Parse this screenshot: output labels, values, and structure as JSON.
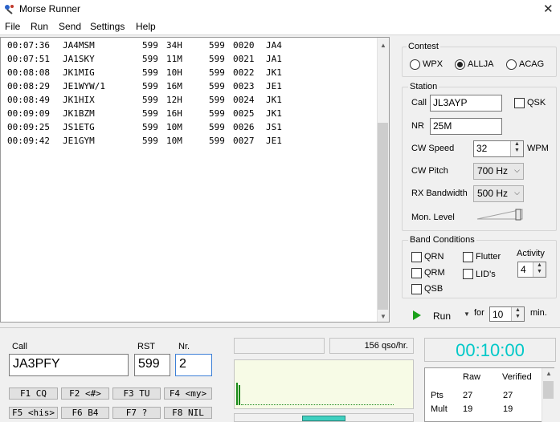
{
  "window": {
    "title": "Morse Runner",
    "close": "✕"
  },
  "menu": [
    "File",
    "Run",
    "Send",
    "Settings",
    "Help"
  ],
  "log": [
    {
      "time": "00:07:36",
      "call": "JA4MSM",
      "rst": "599",
      "exch": "34H",
      "rst_sent": "599",
      "nr": "0020",
      "pfx": "JA4"
    },
    {
      "time": "00:07:51",
      "call": "JA1SKY",
      "rst": "599",
      "exch": "11M",
      "rst_sent": "599",
      "nr": "0021",
      "pfx": "JA1"
    },
    {
      "time": "00:08:08",
      "call": "JK1MIG",
      "rst": "599",
      "exch": "10H",
      "rst_sent": "599",
      "nr": "0022",
      "pfx": "JK1"
    },
    {
      "time": "00:08:29",
      "call": "JE1WYW/1",
      "rst": "599",
      "exch": "16M",
      "rst_sent": "599",
      "nr": "0023",
      "pfx": "JE1"
    },
    {
      "time": "00:08:49",
      "call": "JK1HIX",
      "rst": "599",
      "exch": "12H",
      "rst_sent": "599",
      "nr": "0024",
      "pfx": "JK1"
    },
    {
      "time": "00:09:09",
      "call": "JK1BZM",
      "rst": "599",
      "exch": "16H",
      "rst_sent": "599",
      "nr": "0025",
      "pfx": "JK1"
    },
    {
      "time": "00:09:25",
      "call": "JS1ETG",
      "rst": "599",
      "exch": "10M",
      "rst_sent": "599",
      "nr": "0026",
      "pfx": "JS1"
    },
    {
      "time": "00:09:42",
      "call": "JE1GYM",
      "rst": "599",
      "exch": "10M",
      "rst_sent": "599",
      "nr": "0027",
      "pfx": "JE1"
    }
  ],
  "contest": {
    "label": "Contest",
    "options": [
      "WPX",
      "ALLJA",
      "ACAG"
    ],
    "selected": "ALLJA"
  },
  "station": {
    "label": "Station",
    "call_label": "Call",
    "call": "JL3AYP",
    "qsk_label": "QSK",
    "nr_label": "NR",
    "nr": "25M",
    "speed_label": "CW Speed",
    "speed": "32",
    "speed_unit": "WPM",
    "pitch_label": "CW Pitch",
    "pitch": "700 Hz",
    "bw_label": "RX Bandwidth",
    "bw": "500 Hz",
    "mon_label": "Mon. Level"
  },
  "band": {
    "label": "Band Conditions",
    "qrn": "QRN",
    "qrm": "QRM",
    "qsb": "QSB",
    "flutter": "Flutter",
    "lids": "LID's",
    "activity_label": "Activity",
    "activity": "4"
  },
  "run": {
    "label": "Run",
    "for_label": "for",
    "minutes": "10",
    "min_label": "min."
  },
  "entry": {
    "call_label": "Call",
    "call": "JA3PFY",
    "rst_label": "RST",
    "rst": "599",
    "nr_label": "Nr.",
    "nr": "2"
  },
  "fkeys": [
    "F1 CQ",
    "F2 <#>",
    "F3 TU",
    "F4 <my>",
    "F5 <his>",
    "F6 B4",
    "F7 ?",
    "F8 NIL"
  ],
  "rate": "156 qso/hr.",
  "timer": "00:10:00",
  "score": {
    "headers": [
      "Raw",
      "Verified"
    ],
    "rows": [
      {
        "label": "Pts",
        "raw": "27",
        "verified": "27"
      },
      {
        "label": "Mult",
        "raw": "19",
        "verified": "19"
      }
    ]
  },
  "colors": {
    "timer": "#00c8c8",
    "scope_bg": "#f7fbe6",
    "scope_bar": "#1a8a1a",
    "run_icon": "#1aa01a",
    "tuner": "#40d0c0"
  }
}
